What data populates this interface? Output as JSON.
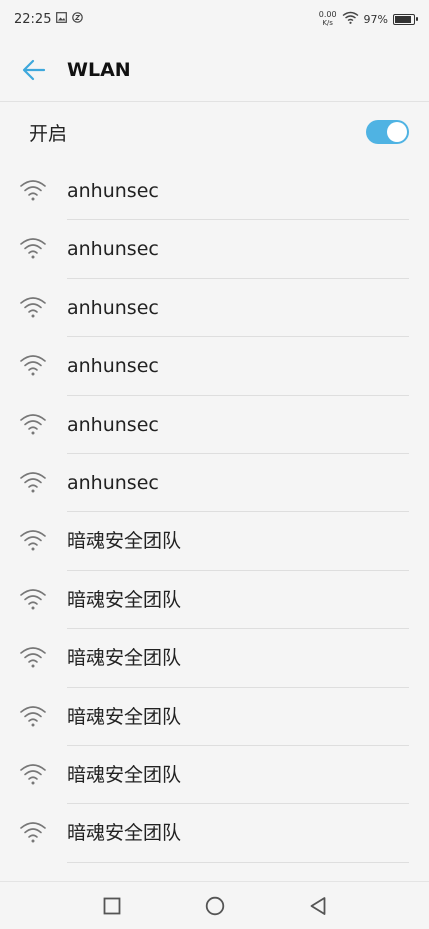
{
  "status_bar": {
    "time": "22:25",
    "net_speed_value": "0.00",
    "net_speed_unit": "K/s",
    "battery_percent": "97%",
    "battery_level": 0.97
  },
  "header": {
    "title": "WLAN",
    "back_icon": "arrow-left-icon"
  },
  "toggle": {
    "label": "开启",
    "on": true,
    "accent_color": "#4fb3e3"
  },
  "networks": [
    {
      "name": "anhunsec"
    },
    {
      "name": "anhunsec"
    },
    {
      "name": "anhunsec"
    },
    {
      "name": "anhunsec"
    },
    {
      "name": "anhunsec"
    },
    {
      "name": "anhunsec"
    },
    {
      "name": "暗魂安全团队"
    },
    {
      "name": "暗魂安全团队"
    },
    {
      "name": "暗魂安全团队"
    },
    {
      "name": "暗魂安全团队"
    },
    {
      "name": "暗魂安全团队"
    },
    {
      "name": "暗魂安全团队"
    }
  ],
  "nav_bar": {
    "recents_icon": "square-icon",
    "home_icon": "circle-icon",
    "back_icon": "triangle-back-icon"
  }
}
